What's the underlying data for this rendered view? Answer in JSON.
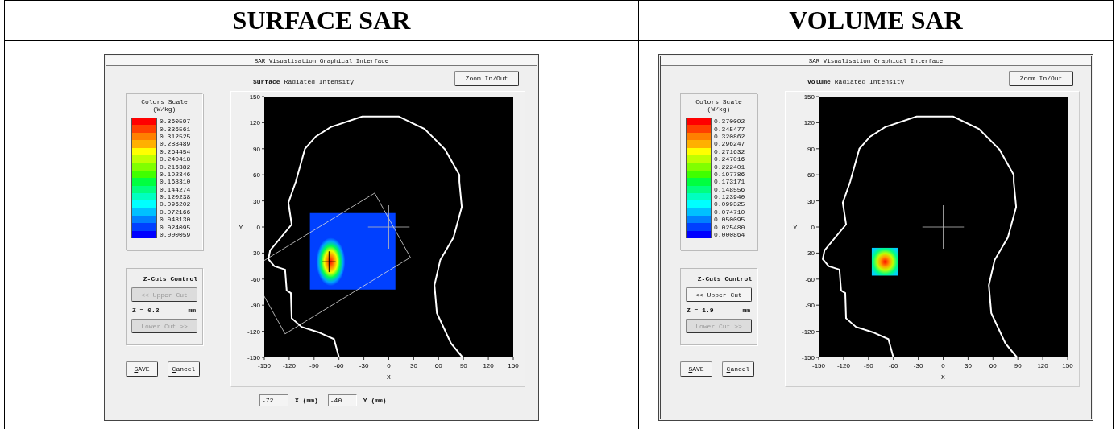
{
  "panels": [
    {
      "heading": "SURFACE SAR",
      "kind": "surface",
      "window": {
        "title": "SAR Visualisation Graphical Interface",
        "mode": "Surface",
        "subtitle": "Radiated Intensity",
        "zoom_button": "Zoom In/Out",
        "scale": {
          "title": "Colors Scale",
          "unit": "(W/kg)",
          "entries": [
            {
              "value": "0.360597",
              "color": "#ff0000"
            },
            {
              "value": "0.336561",
              "color": "#ff4000"
            },
            {
              "value": "0.312525",
              "color": "#ff8000"
            },
            {
              "value": "0.288489",
              "color": "#ffb000"
            },
            {
              "value": "0.264454",
              "color": "#ffff00"
            },
            {
              "value": "0.240418",
              "color": "#c0ff00"
            },
            {
              "value": "0.216382",
              "color": "#80ff00"
            },
            {
              "value": "0.192346",
              "color": "#40ff00"
            },
            {
              "value": "0.168310",
              "color": "#00ff40"
            },
            {
              "value": "0.144274",
              "color": "#00ff80"
            },
            {
              "value": "0.120238",
              "color": "#00ffc0"
            },
            {
              "value": "0.096202",
              "color": "#00ffff"
            },
            {
              "value": "0.072166",
              "color": "#00c0ff"
            },
            {
              "value": "0.048130",
              "color": "#0080ff"
            },
            {
              "value": "0.024095",
              "color": "#0040ff"
            },
            {
              "value": "0.000059",
              "color": "#0000ff"
            }
          ]
        },
        "zcuts": {
          "title": "Z-Cuts Control",
          "upper_cut": {
            "label": "<< Upper Cut",
            "disabled": true
          },
          "z_label": "Z = 0.2",
          "z_unit": "mm",
          "lower_cut": {
            "label": "Lower Cut >>",
            "disabled": true
          }
        },
        "save": "SAVE",
        "cancel": "Cancel",
        "plot": {
          "xticks": [
            "-150",
            "-120",
            "-90",
            "-60",
            "-30",
            "0",
            "30",
            "60",
            "90",
            "120",
            "150"
          ],
          "yticks": [
            "150",
            "120",
            "90",
            "60",
            "30",
            "0",
            "-30",
            "-60",
            "-90",
            "-120",
            "-150"
          ],
          "xlabel": "X",
          "ylabel": "Y"
        },
        "coordinates": {
          "x_value": "-72",
          "x_label": "X (mm)",
          "y_value": "-40",
          "y_label": "Y (mm)"
        }
      }
    },
    {
      "heading": "VOLUME SAR",
      "kind": "volume",
      "window": {
        "title": "SAR Visualisation Graphical Interface",
        "mode": "Volume",
        "subtitle": "Radiated Intensity",
        "zoom_button": "Zoom In/Out",
        "scale": {
          "title": "Colors Scale",
          "unit": "(W/kg)",
          "entries": [
            {
              "value": "0.370092",
              "color": "#ff0000"
            },
            {
              "value": "0.345477",
              "color": "#ff4000"
            },
            {
              "value": "0.320862",
              "color": "#ff8000"
            },
            {
              "value": "0.296247",
              "color": "#ffb000"
            },
            {
              "value": "0.271632",
              "color": "#ffff00"
            },
            {
              "value": "0.247016",
              "color": "#c0ff00"
            },
            {
              "value": "0.222401",
              "color": "#80ff00"
            },
            {
              "value": "0.197786",
              "color": "#40ff00"
            },
            {
              "value": "0.173171",
              "color": "#00ff40"
            },
            {
              "value": "0.148556",
              "color": "#00ff80"
            },
            {
              "value": "0.123940",
              "color": "#00ffc0"
            },
            {
              "value": "0.099325",
              "color": "#00ffff"
            },
            {
              "value": "0.074710",
              "color": "#00c0ff"
            },
            {
              "value": "0.050095",
              "color": "#0080ff"
            },
            {
              "value": "0.025480",
              "color": "#0040ff"
            },
            {
              "value": "0.000864",
              "color": "#0000ff"
            }
          ]
        },
        "zcuts": {
          "title": "Z-Cuts Control",
          "upper_cut": {
            "label": "<< Upper Cut",
            "disabled": false
          },
          "z_label": "Z = 1.9",
          "z_unit": "mm",
          "lower_cut": {
            "label": "Lower Cut >>",
            "disabled": true
          }
        },
        "save": "SAVE",
        "cancel": "Cancel",
        "plot": {
          "xticks": [
            "-150",
            "-120",
            "-90",
            "-60",
            "-30",
            "0",
            "30",
            "60",
            "90",
            "120",
            "150"
          ],
          "yticks": [
            "150",
            "120",
            "90",
            "60",
            "30",
            "0",
            "-30",
            "-60",
            "-90",
            "-120",
            "-150"
          ],
          "xlabel": "X",
          "ylabel": "Y"
        }
      }
    }
  ]
}
